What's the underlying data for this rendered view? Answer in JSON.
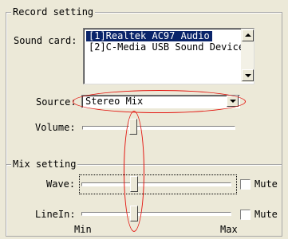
{
  "record_setting": {
    "legend": "Record setting",
    "sound_card_label": "Sound card:",
    "sound_cards": [
      "[1]Realtek AC97 Audio",
      "[2]C-Media USB Sound Device"
    ],
    "selected_index": 0,
    "source_label": "Source:",
    "source_value": "Stereo Mix",
    "volume_label": "Volume:"
  },
  "mix_setting": {
    "legend": "Mix setting",
    "wave_label": "Wave:",
    "wave_mute_label": "Mute",
    "linein_label": "LineIn:",
    "linein_mute_label": "Mute",
    "min_label": "Min",
    "max_label": "Max"
  },
  "annotation_color": "#e3140e"
}
